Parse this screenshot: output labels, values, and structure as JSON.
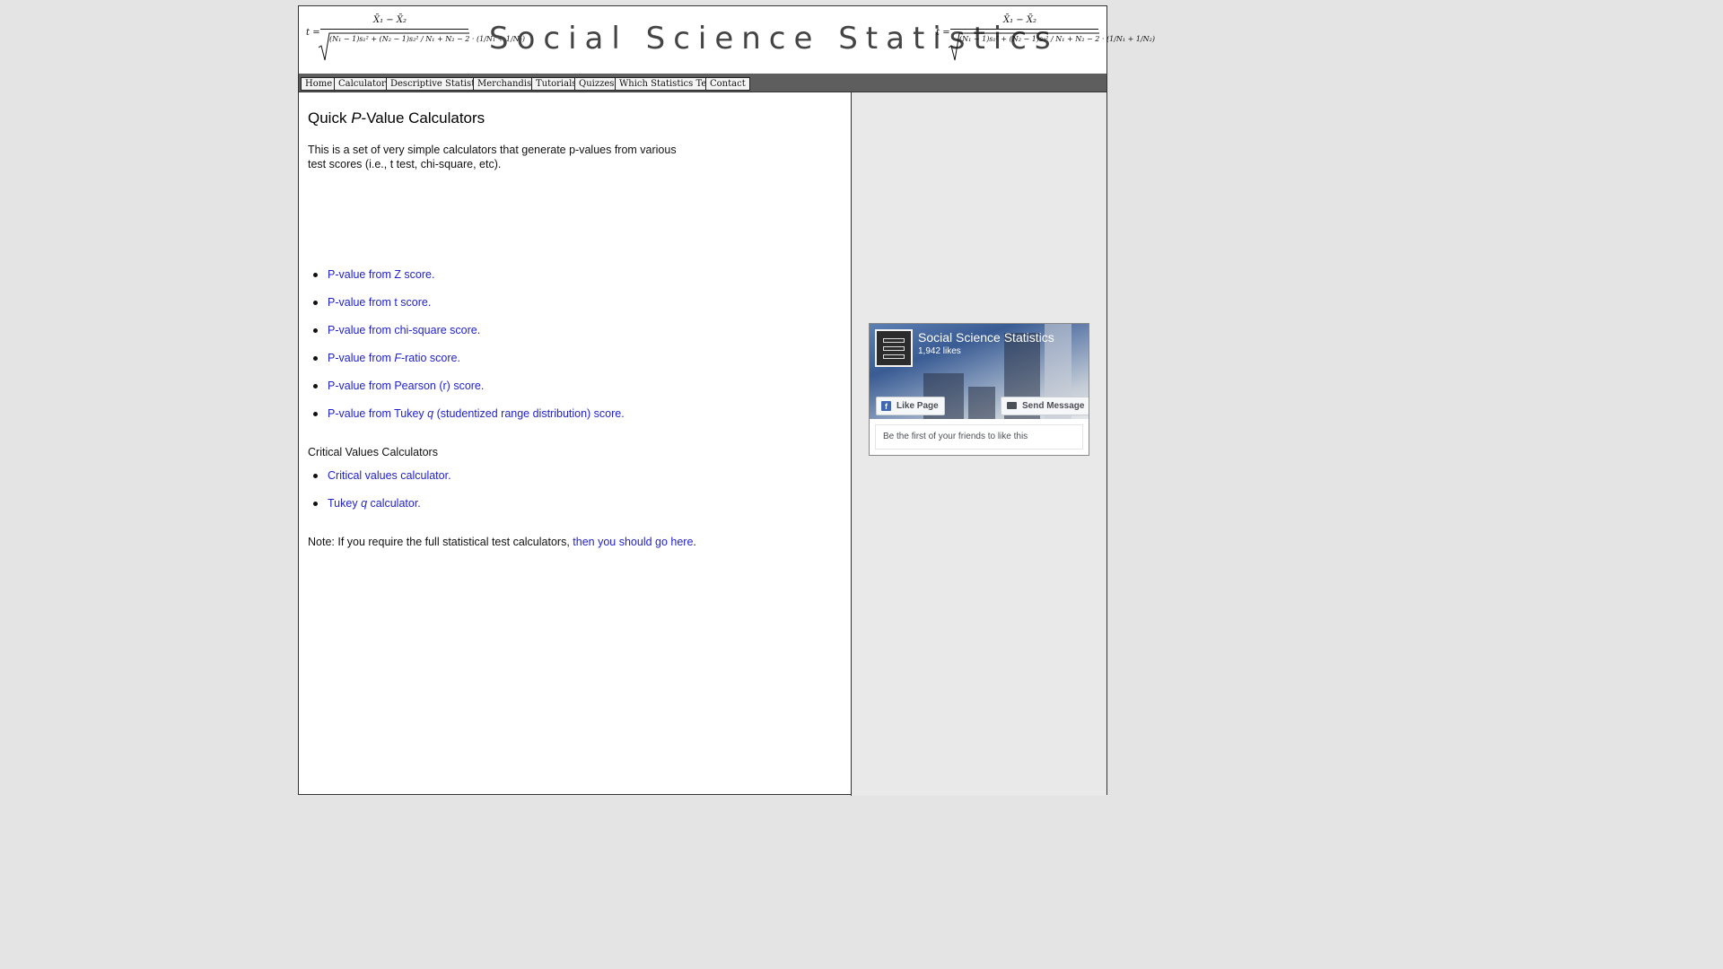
{
  "header": {
    "site_title": "Social Science Statistics",
    "formula_left": {
      "t_eq": "t =",
      "numerator": "X̄₁ − X̄₂",
      "denominator": "(N₁ − 1)s₁² + (N₂ − 1)s₂² / N₁ + N₂ − 2 · (1/N₁ + 1/N₂)"
    },
    "formula_right": {
      "t_eq": "t =",
      "numerator": "X̄₁ − X̄₂",
      "denominator": "(N₁ − 1)s₁² + (N₂ − 1)s₂² / N₁ + N₂ − 2 · (1/N₁ + 1/N₂)"
    }
  },
  "nav": {
    "items": [
      {
        "label": "Home"
      },
      {
        "label": "Calculators"
      },
      {
        "label": "Descriptive Statistics"
      },
      {
        "label": "Merchandise"
      },
      {
        "label": "Tutorials"
      },
      {
        "label": "Quizzes"
      },
      {
        "label": "Which Statistics Test?"
      },
      {
        "label": "Contact"
      }
    ]
  },
  "main": {
    "title_prefix": "Quick ",
    "title_italic": "P",
    "title_suffix": "-Value Calculators",
    "intro": "This is a set of very simple calculators that generate p-values from various test scores (i.e., t test, chi-square, etc).",
    "pvalue_links": [
      {
        "text": "P-value from Z score"
      },
      {
        "text": "P-value from t score"
      },
      {
        "text": "P-value from chi-square score"
      },
      {
        "text_prefix": "P-value from ",
        "text_italic": "F",
        "text_suffix": "-ratio score"
      },
      {
        "text": "P-value from Pearson (r) score"
      },
      {
        "text_prefix": "P-value from Tukey ",
        "text_italic": "q",
        "text_suffix": " (studentized range distribution) score"
      }
    ],
    "critical_heading": "Critical Values Calculators",
    "critical_links": [
      {
        "text": "Critical values calculator"
      },
      {
        "text_prefix": "Tukey ",
        "text_italic": "q",
        "text_suffix": " calculator"
      }
    ],
    "note_text": "Note: If you require the full statistical test calculators, ",
    "note_link": "then you should go here",
    "note_end": "."
  },
  "facebook": {
    "page_name": "Social Science Statistics",
    "likes": "1,942 likes",
    "like_button": "Like Page",
    "message_button": "Send Message",
    "friends_text": "Be the first of your friends to like this"
  },
  "colors": {
    "link": "#2222cc",
    "nav_bar": "#5e5e5e",
    "sidebar": "#e9e9e9",
    "page_bg": "#e4e4e4",
    "fb_blue": "#4267b2"
  },
  "icons": {
    "bullet": "bullet-dot-icon",
    "facebook": "facebook-f-icon",
    "message": "message-icon"
  }
}
